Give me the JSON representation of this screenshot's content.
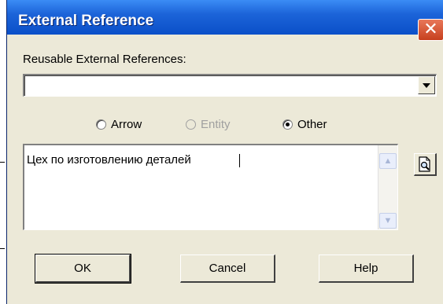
{
  "window": {
    "title": "External Reference",
    "close_icon": "close-icon"
  },
  "reusable": {
    "label": "Reusable External References:",
    "value": ""
  },
  "radios": [
    {
      "label": "Arrow",
      "checked": false,
      "enabled": true
    },
    {
      "label": "Entity",
      "checked": false,
      "enabled": false
    },
    {
      "label": "Other",
      "checked": true,
      "enabled": true
    }
  ],
  "memo": {
    "text": "Цех по изготовлению деталей"
  },
  "side_button": {
    "icon": "magnifier-document-icon"
  },
  "buttons": {
    "ok": "OK",
    "cancel": "Cancel",
    "help": "Help"
  },
  "colors": {
    "title_bar": "#1c64d9",
    "close": "#c7401e",
    "dialog_bg": "#ece9d8"
  }
}
